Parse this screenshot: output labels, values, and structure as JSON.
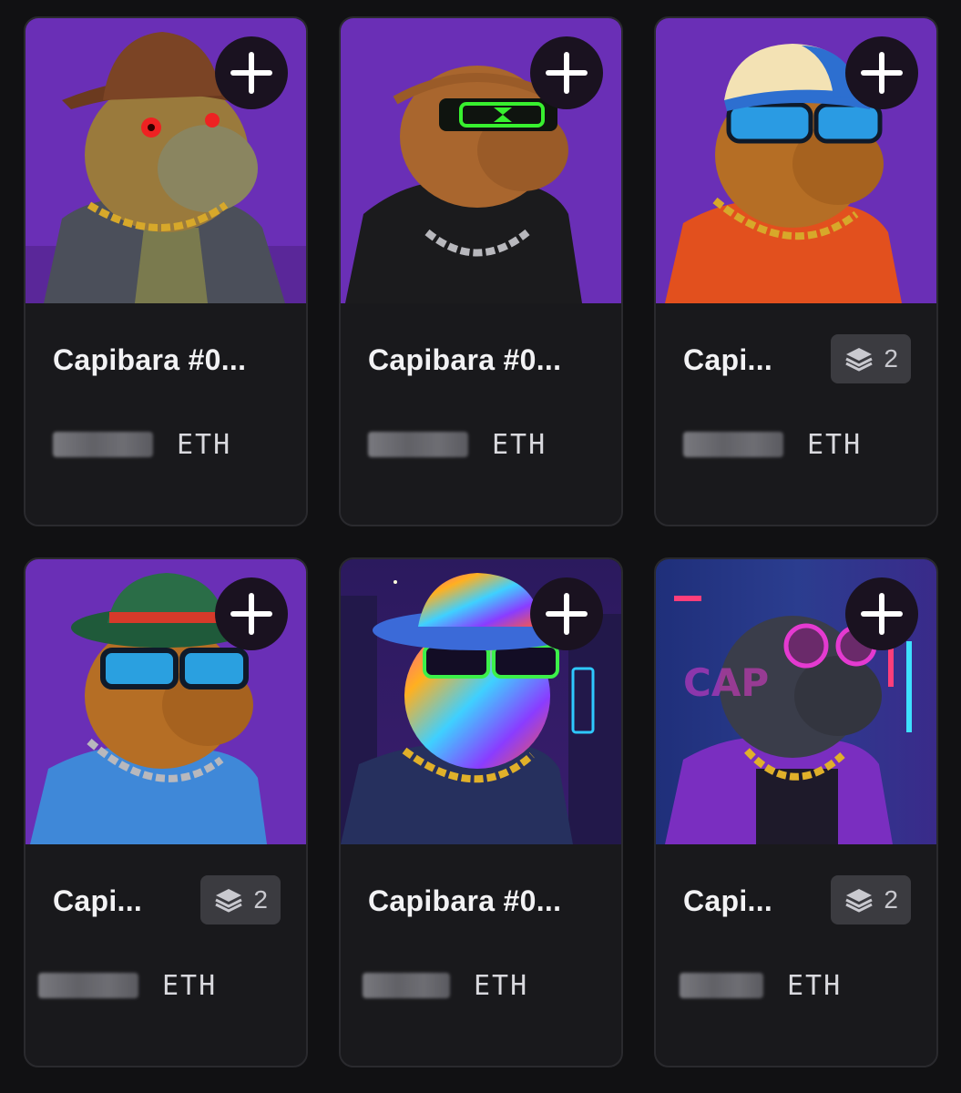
{
  "colors": {
    "background": "#111113",
    "card": "#19191c",
    "art_purple": "#6a2fb6",
    "badge": "#3b3b40"
  },
  "cards": [
    {
      "name": "Capibara #0...",
      "currency": "ETH",
      "edition": "",
      "hat": "cowboy hat",
      "eyes": "red eyes"
    },
    {
      "name": "Capibara #0...",
      "currency": "ETH",
      "edition": "",
      "hat": "none",
      "eyes": "green visor"
    },
    {
      "name": "Capi...",
      "currency": "ETH",
      "edition": "2",
      "hat": "baseball cap",
      "eyes": "blue sunglasses"
    },
    {
      "name": "Capi...",
      "currency": "ETH",
      "edition": "2",
      "hat": "green fedora",
      "eyes": "blue sunglasses"
    },
    {
      "name": "Capibara #0...",
      "currency": "ETH",
      "edition": "",
      "hat": "psychedelic bucket hat",
      "eyes": "green sunglasses"
    },
    {
      "name": "Capi...",
      "currency": "ETH",
      "edition": "2",
      "hat": "none",
      "eyes": "pink round glasses"
    }
  ],
  "icons": {
    "add": "plus-icon",
    "edition": "layers-icon"
  }
}
